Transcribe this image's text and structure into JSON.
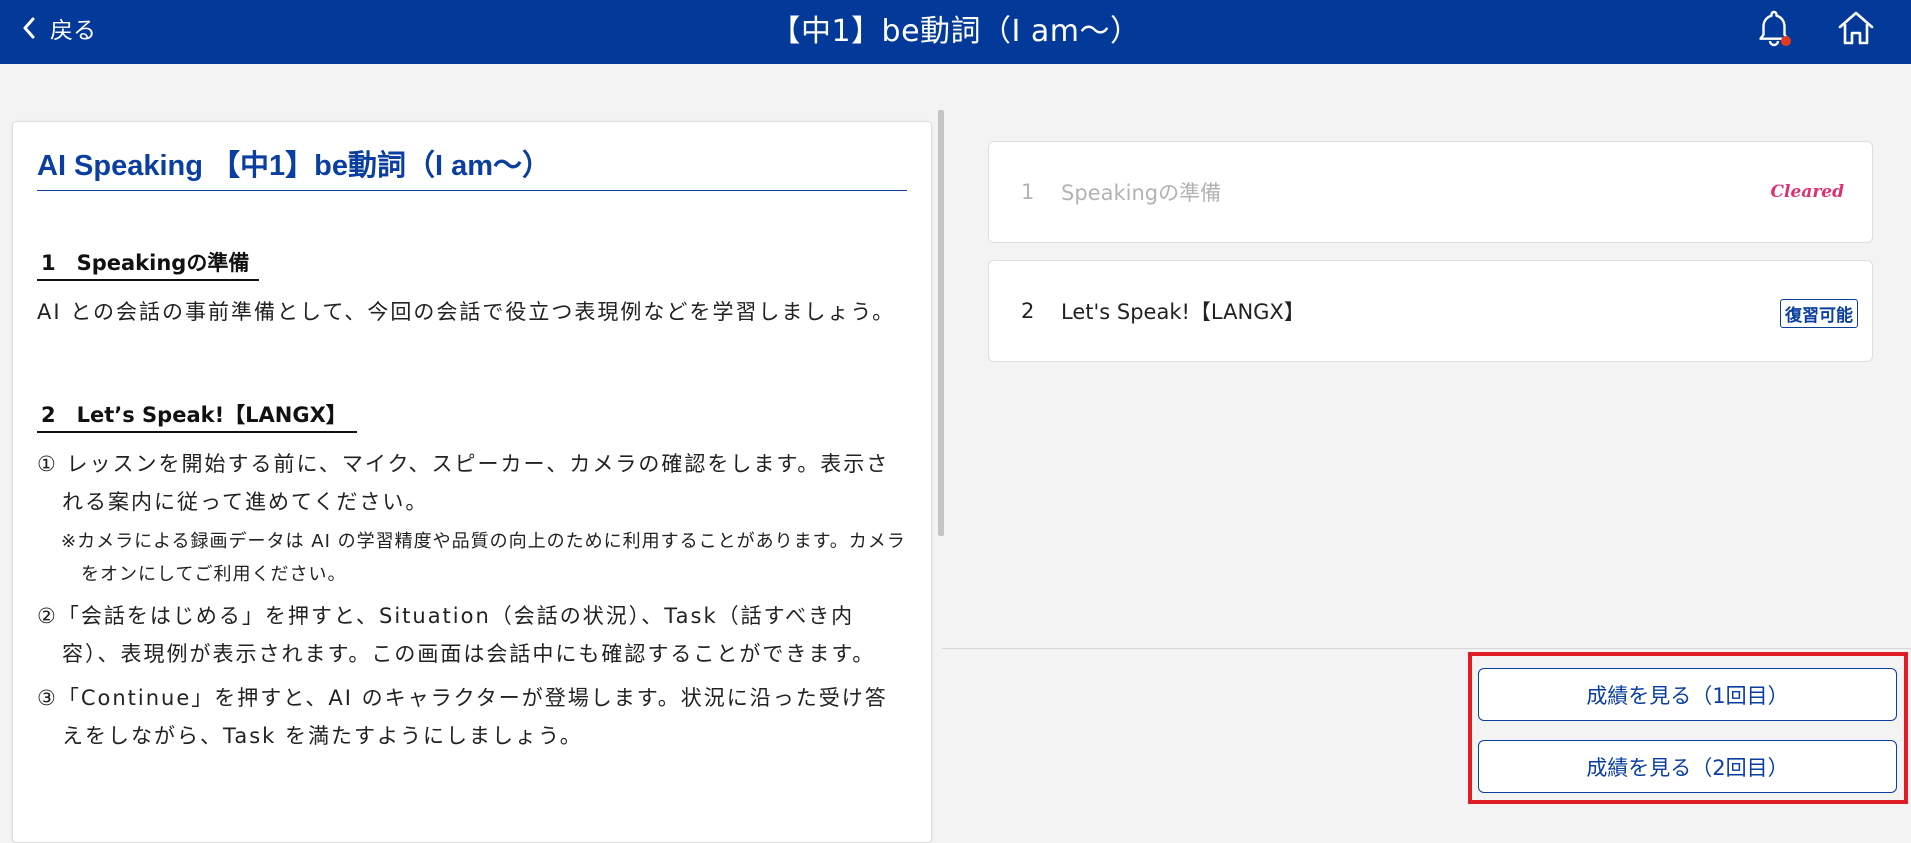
{
  "header": {
    "back_label": "戻る",
    "title": "【中1】be動詞（I am〜）",
    "icons": [
      "chevron-left-icon",
      "bell-icon",
      "home-icon"
    ],
    "notification_dot_color": "#e53a1f"
  },
  "document": {
    "title": "AI Speaking 【中1】be動詞（I am〜）",
    "section1": {
      "heading": "1　Speakingの準備",
      "text": "AI との会話の事前準備として、今回の会話で役立つ表現例などを学習しましょう。"
    },
    "section2": {
      "heading": "2　Let’s Speak!【LANGX】",
      "steps": [
        "① レッスンを開始する前に、マイク、スピーカー、カメラの確認をします。表示される案内に従って進めてください。",
        "※カメラによる録画データは AI の学習精度や品質の向上のために利用することがあります。カメラをオンにしてご利用ください。",
        "②「会話をはじめる」を押すと、Situation（会話の状況）、Task（話すべき内容）、表現例が表示されます。この画面は会話中にも確認することができます。",
        "③「Continue」を押すと、AI のキャラクターが登場します。状況に沿った受け答えをしながら、Task を満たすようにしましょう。"
      ]
    }
  },
  "lessons": [
    {
      "number": "1",
      "label": "Speakingの準備",
      "status": "Cleared"
    },
    {
      "number": "2",
      "label": "Let's Speak!【LANGX】",
      "status": "復習可能"
    }
  ],
  "score_buttons": [
    "成績を見る（1回目）",
    "成績を見る（2回目）"
  ],
  "colors": {
    "header_bg": "#033a99",
    "accent": "#0b3ea1",
    "cleared": "#e0306f",
    "highlight_border": "#e01d25",
    "page_bg": "#f3f3f3"
  }
}
